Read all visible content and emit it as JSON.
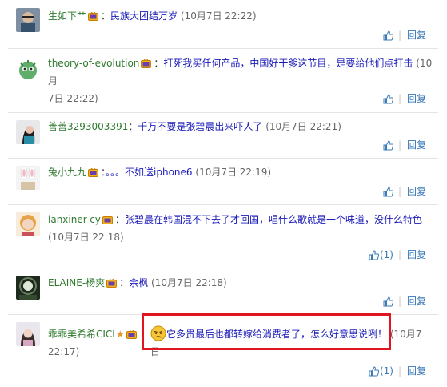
{
  "comments": [
    {
      "user": "生如下艹",
      "message": "民族大团结万岁",
      "time": "(10月7日 22:22)",
      "like_count": "",
      "reply": "回复"
    },
    {
      "user": "theory-of-evolution",
      "message": "打死我买任何产品，中国好干爹这节目，是要给他们点打击",
      "time_part1": "(10月",
      "time_part2": "7日 22:22)",
      "like_count": "",
      "reply": "回复"
    },
    {
      "user": "善善3293003391",
      "message": "千万不要是张碧晨出来吓人了",
      "time": "(10月7日 22:21)",
      "like_count": "",
      "reply": "回复"
    },
    {
      "user": "兔小九九",
      "message": "。。。不如送iphone6",
      "time": "(10月7日 22:19)",
      "like_count": "",
      "reply": "回复"
    },
    {
      "user": "lanxiner-cy",
      "message": "张碧晨在韩国混不下去了才回国，唱什么歌就是一个味道，没什么特色",
      "time": "(10月7日 22:18)",
      "like_count": "(1)",
      "reply": "回复"
    },
    {
      "user": "ELAINE-杨爽",
      "message": "余枫",
      "time": "(10月7日 22:18)",
      "like_count": "",
      "reply": "回复"
    },
    {
      "user": "乖乖美希希CICI",
      "message": "它多贵最后也都转嫁给消费者了，怎么好意思说咧！",
      "time_part1": "(10月",
      "time_part2": "7日",
      "time_part3": "22:17)",
      "like_count": "(1)",
      "reply": "回复"
    }
  ],
  "colors": {
    "username": "#2f7a2f",
    "message": "#1a1ab8",
    "link": "#3a79b8",
    "highlight": "#e0151f"
  }
}
